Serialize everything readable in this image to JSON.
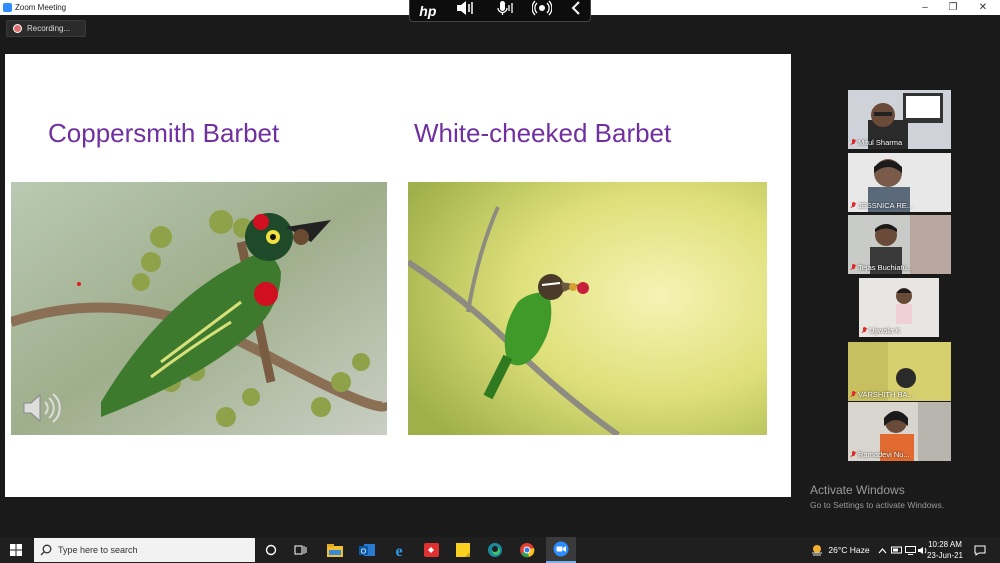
{
  "window": {
    "title": "Zoom Meeting",
    "minimize": "–",
    "maximize": "❐",
    "close": "✕"
  },
  "hp_toolbar": {
    "logo": "hp"
  },
  "recording": {
    "label": "Recording..."
  },
  "slide": {
    "left_title": "Coppersmith Barbet",
    "right_title": "White-cheeked Barbet"
  },
  "participants": [
    {
      "name": "Mitul Sharma"
    },
    {
      "name": "JESSNICA RE..."
    },
    {
      "name": "Tejas Buchiatu..."
    },
    {
      "name": "Ujjwala K"
    },
    {
      "name": "VARSHITH BA..."
    },
    {
      "name": "Ramadevi Nu..."
    }
  ],
  "activate": {
    "title": "Activate Windows",
    "subtitle": "Go to Settings to activate Windows."
  },
  "taskbar": {
    "search_placeholder": "Type here to search",
    "weather": "26°C  Haze",
    "time": "10:28 AM",
    "date": "23-Jun-21"
  }
}
